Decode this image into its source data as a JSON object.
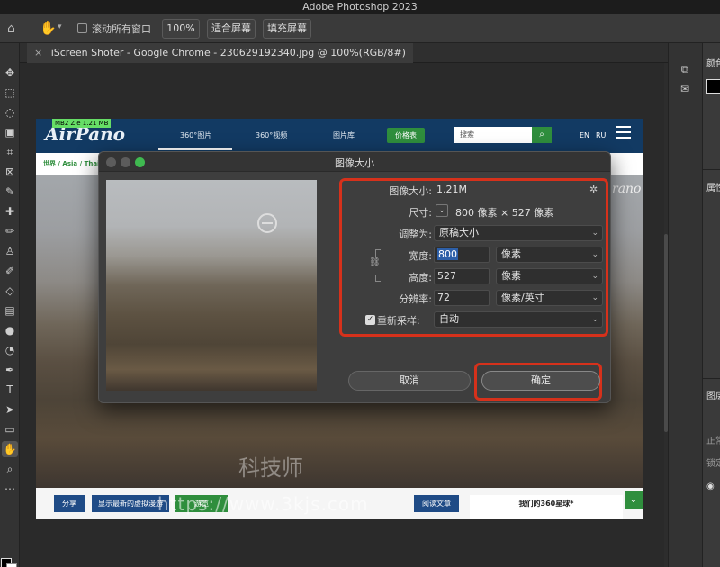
{
  "titlebar": {
    "app_title": "Adobe Photoshop 2023",
    "right_mark": ""
  },
  "options": {
    "scroll_all_windows": "滚动所有窗口",
    "btn_100": "100%",
    "btn_fit": "适合屏幕",
    "btn_fill": "填充屏幕"
  },
  "document_tab": {
    "close": "×",
    "title": "iScreen Shoter - Google Chrome - 230629192340.jpg @ 100%(RGB/8#)"
  },
  "site": {
    "logo": "AirPano",
    "tabs": [
      "360°图片",
      "360°视频",
      "图片库"
    ],
    "price_button": "价格表",
    "search_placeholder": "搜索",
    "search_icon": "search-icon",
    "lang_en": "EN",
    "lang_ru": "RU",
    "breadcrumb": "世界 / Asia / Thailan",
    "mini_tag": "MB2 Zie 1.21 MB",
    "footer_buttons": [
      "分享",
      "显示最新的虚拟漫游",
      "游览",
      "阅读文章"
    ],
    "footer_box": "我们的360星球*",
    "footer_green_icon": "chevron-down-icon",
    "right_overlay": "rano"
  },
  "watermark": {
    "url": "https://www.3kjs.com",
    "cn": "科技师"
  },
  "dialog": {
    "title": "图像大小",
    "image_size_label": "图像大小:",
    "image_size_value": "1.21M",
    "dimensions_label": "尺寸:",
    "dimensions_value": "800 像素  ×  527 像素",
    "fit_to_label": "调整为:",
    "fit_to_value": "原稿大小",
    "width_label": "宽度:",
    "width_value": "800",
    "width_unit": "像素",
    "height_label": "高度:",
    "height_value": "527",
    "height_unit": "像素",
    "resolution_label": "分辨率:",
    "resolution_value": "72",
    "resolution_unit": "像素/英寸",
    "resample_label": "重新采样:",
    "resample_value": "自动",
    "resample_checked": true,
    "cancel_label": "取消",
    "ok_label": "确定"
  },
  "right_panel": {
    "color_label": "颜色",
    "properties_label": "属性",
    "layers_label": "图层",
    "normal": "正常",
    "lock": "锁定"
  },
  "colors": {
    "accent_red": "#d6311b",
    "site_blue": "#123a63",
    "site_green": "#2f8e3d"
  }
}
